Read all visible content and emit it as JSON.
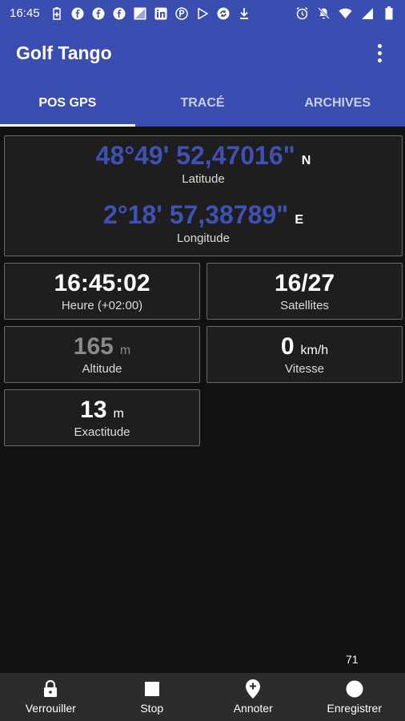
{
  "status_bar": {
    "time": "16:45",
    "left_icons": [
      "battery-saver-icon",
      "facebook-icon",
      "facebook-icon",
      "facebook-icon",
      "image-icon",
      "linkedin-icon",
      "pay-icon",
      "play-store-icon",
      "sync-icon",
      "download-icon"
    ],
    "right_icons": [
      "alarm-icon",
      "notifications-off-icon",
      "wifi-icon",
      "signal-icon",
      "battery-icon"
    ]
  },
  "app": {
    "title": "Golf Tango",
    "menu_icon": "more-vert-icon"
  },
  "tabs": [
    {
      "label": "POS GPS",
      "active": true
    },
    {
      "label": "TRACÉ",
      "active": false
    },
    {
      "label": "ARCHIVES",
      "active": false
    }
  ],
  "position": {
    "latitude_value": "48°49' 52,47016\"",
    "latitude_dir": "N",
    "latitude_label": "Latitude",
    "longitude_value": "2°18' 57,38789\"",
    "longitude_dir": "E",
    "longitude_label": "Longitude"
  },
  "time_card": {
    "value": "16:45:02",
    "label": "Heure (+02:00)"
  },
  "satellites_card": {
    "value": "16/27",
    "label": "Satellites"
  },
  "altitude_card": {
    "value": "165",
    "unit": "m",
    "label": "Altitude"
  },
  "speed_card": {
    "value": "0",
    "unit": "km/h",
    "label": "Vitesse"
  },
  "accuracy_card": {
    "value": "13",
    "unit": "m",
    "label": "Exactitude"
  },
  "counter": "71",
  "bottom_nav": [
    {
      "label": "Verrouiller",
      "icon": "lock-icon"
    },
    {
      "label": "Stop",
      "icon": "stop-icon"
    },
    {
      "label": "Annoter",
      "icon": "add-location-icon"
    },
    {
      "label": "Enregistrer",
      "icon": "record-icon"
    }
  ],
  "colors": {
    "primary": "#3a4db1",
    "coordinate_text": "#3f51b5",
    "background": "#111111",
    "card_background": "#1e1e1e",
    "nav_background": "#2c2c2c"
  }
}
